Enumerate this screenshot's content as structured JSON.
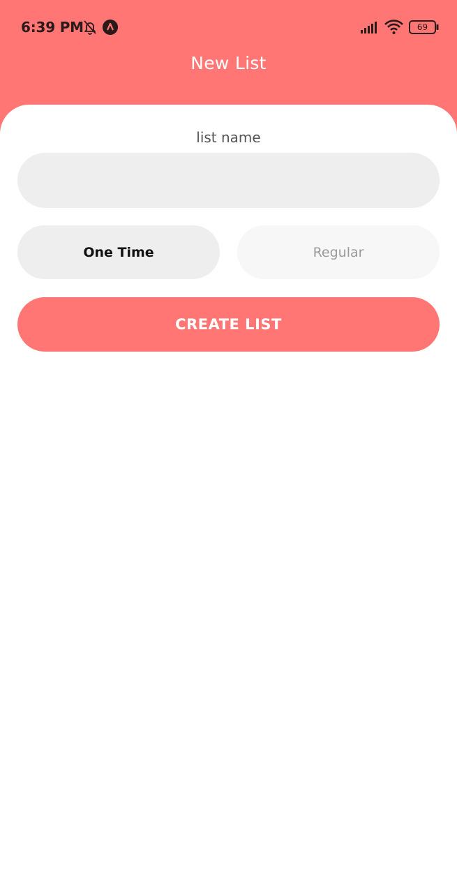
{
  "status_bar": {
    "time": "6:39 PM",
    "battery": "69",
    "icons": [
      "bell-off-icon",
      "app-notification-icon",
      "signal-icon",
      "wifi-icon",
      "battery-icon"
    ]
  },
  "header": {
    "title": "New List"
  },
  "form": {
    "name_label": "list name",
    "name_value": "",
    "name_placeholder": "",
    "type_options": [
      "One Time",
      "Regular"
    ],
    "selected_type": "One Time",
    "submit_label": "CREATE LIST"
  },
  "colors": {
    "accent": "#ff7675",
    "input_bg": "#eeeeee",
    "selected_toggle_bg": "#eeeeee",
    "unselected_toggle_bg": "#f7f7f7"
  }
}
